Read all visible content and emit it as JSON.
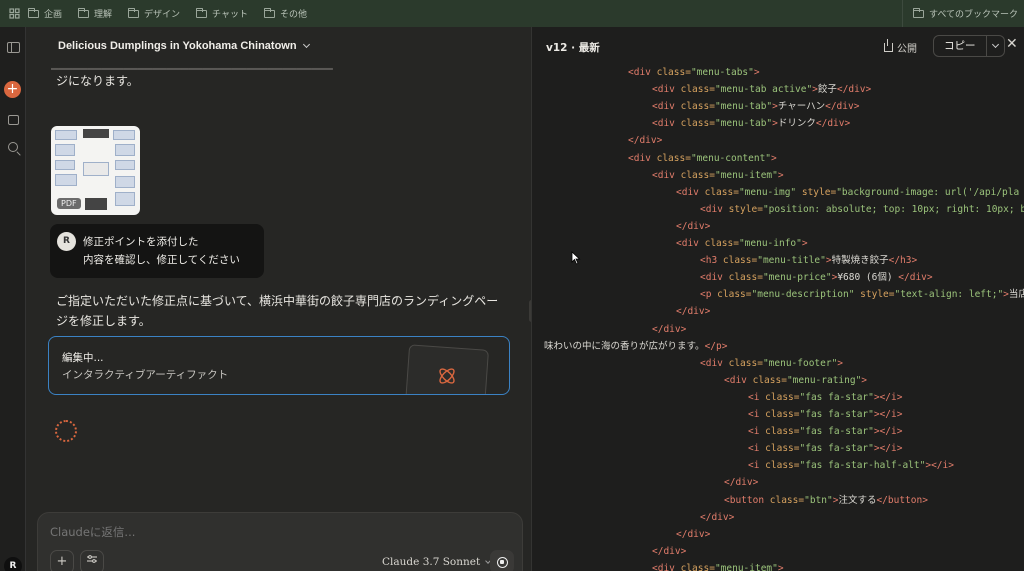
{
  "bookmarks_bar": {
    "items": [
      "企画",
      "理解",
      "デザイン",
      "チャット",
      "その他"
    ],
    "all_bookmarks": "すべてのブックマーク"
  },
  "rail": {
    "avatar": "R"
  },
  "chat": {
    "title": "Delicious Dumplings in Yokohama Chinatown",
    "prev_text": "ジになります。",
    "attachment": {
      "badge": "PDF"
    },
    "user_message": {
      "avatar": "R",
      "line1": "修正ポイントを添付した",
      "line2": "内容を確認し、修正してください"
    },
    "assistant_line1": "ご指定いただいた修正点に基づいて、横浜中華街の餃子専門店のランディングペー",
    "assistant_line2": "ジを修正します。",
    "artifact": {
      "title": "編集中...",
      "subtitle": "インタラクティブアーティファクト"
    },
    "composer": {
      "placeholder": "Claudeに返信...",
      "model": "Claude 3.7 Sonnet"
    }
  },
  "artifact_pane": {
    "version": "v12 · 最新",
    "publish": "公開",
    "copy": "コピー",
    "code_lines": [
      {
        "indent": 3,
        "parts": [
          [
            "tg",
            "<div "
          ],
          [
            "at",
            "class="
          ],
          [
            "st",
            "\"menu-tabs\""
          ],
          [
            "tg",
            ">"
          ]
        ]
      },
      {
        "indent": 4,
        "parts": [
          [
            "tg",
            "<div "
          ],
          [
            "at",
            "class="
          ],
          [
            "st",
            "\"menu-tab active\""
          ],
          [
            "tg",
            ">"
          ],
          [
            "tx",
            "餃子"
          ],
          [
            "tg",
            "</div>"
          ]
        ]
      },
      {
        "indent": 4,
        "parts": [
          [
            "tg",
            "<div "
          ],
          [
            "at",
            "class="
          ],
          [
            "st",
            "\"menu-tab\""
          ],
          [
            "tg",
            ">"
          ],
          [
            "tx",
            "チャーハン"
          ],
          [
            "tg",
            "</div>"
          ]
        ]
      },
      {
        "indent": 4,
        "parts": [
          [
            "tg",
            "<div "
          ],
          [
            "at",
            "class="
          ],
          [
            "st",
            "\"menu-tab\""
          ],
          [
            "tg",
            ">"
          ],
          [
            "tx",
            "ドリンク"
          ],
          [
            "tg",
            "</div>"
          ]
        ]
      },
      {
        "indent": 3,
        "parts": [
          [
            "tg",
            "</div>"
          ]
        ]
      },
      {
        "indent": 3,
        "parts": [
          [
            "tg",
            "<div "
          ],
          [
            "at",
            "class="
          ],
          [
            "st",
            "\"menu-content\""
          ],
          [
            "tg",
            ">"
          ]
        ]
      },
      {
        "indent": 4,
        "parts": [
          [
            "tg",
            "<div "
          ],
          [
            "at",
            "class="
          ],
          [
            "st",
            "\"menu-item\""
          ],
          [
            "tg",
            ">"
          ]
        ]
      },
      {
        "indent": 5,
        "parts": [
          [
            "tg",
            "<div "
          ],
          [
            "at",
            "class="
          ],
          [
            "st",
            "\"menu-img\" "
          ],
          [
            "at",
            "style="
          ],
          [
            "st",
            "\"background-image: url('/api/pla"
          ]
        ]
      },
      {
        "indent": 6,
        "parts": [
          [
            "tg",
            "<div "
          ],
          [
            "at",
            "style="
          ],
          [
            "st",
            "\"position: absolute; top: 10px; right: 10px; b"
          ]
        ]
      },
      {
        "indent": 5,
        "parts": [
          [
            "tg",
            "</div>"
          ]
        ]
      },
      {
        "indent": 5,
        "parts": [
          [
            "tg",
            "<div "
          ],
          [
            "at",
            "class="
          ],
          [
            "st",
            "\"menu-info\""
          ],
          [
            "tg",
            ">"
          ]
        ]
      },
      {
        "indent": 6,
        "parts": [
          [
            "tg",
            "<h3 "
          ],
          [
            "at",
            "class="
          ],
          [
            "st",
            "\"menu-title\""
          ],
          [
            "tg",
            ">"
          ],
          [
            "tx",
            "特製焼き餃子"
          ],
          [
            "tg",
            "</h3>"
          ]
        ]
      },
      {
        "indent": 6,
        "parts": [
          [
            "tg",
            "<div "
          ],
          [
            "at",
            "class="
          ],
          [
            "st",
            "\"menu-price\""
          ],
          [
            "tg",
            ">"
          ],
          [
            "tx",
            "¥680 (6個) "
          ],
          [
            "tg",
            "</div>"
          ]
        ]
      },
      {
        "indent": 6,
        "parts": [
          [
            "tg",
            "<p "
          ],
          [
            "at",
            "class="
          ],
          [
            "st",
            "\"menu-description\" "
          ],
          [
            "at",
            "style="
          ],
          [
            "st",
            "\"text-align: left;\""
          ],
          [
            "tg",
            ">"
          ],
          [
            "tx",
            "当店"
          ]
        ]
      },
      {
        "indent": 5,
        "parts": [
          [
            "tg",
            "</div>"
          ]
        ]
      },
      {
        "indent": 4,
        "parts": [
          [
            "tg",
            "</div>"
          ]
        ]
      },
      {
        "indent": 0,
        "parts": [
          [
            "tx",
            "味わいの中に海の香りが広がります。"
          ],
          [
            "tg",
            "</p>"
          ]
        ]
      },
      {
        "indent": 6,
        "parts": [
          [
            "tg",
            "<div "
          ],
          [
            "at",
            "class="
          ],
          [
            "st",
            "\"menu-footer\""
          ],
          [
            "tg",
            ">"
          ]
        ]
      },
      {
        "indent": 7,
        "parts": [
          [
            "tg",
            "<div "
          ],
          [
            "at",
            "class="
          ],
          [
            "st",
            "\"menu-rating\""
          ],
          [
            "tg",
            ">"
          ]
        ]
      },
      {
        "indent": 8,
        "parts": [
          [
            "tg",
            "<i "
          ],
          [
            "at",
            "class="
          ],
          [
            "st",
            "\"fas fa-star\""
          ],
          [
            "tg",
            "></i>"
          ]
        ]
      },
      {
        "indent": 8,
        "parts": [
          [
            "tg",
            "<i "
          ],
          [
            "at",
            "class="
          ],
          [
            "st",
            "\"fas fa-star\""
          ],
          [
            "tg",
            "></i>"
          ]
        ]
      },
      {
        "indent": 8,
        "parts": [
          [
            "tg",
            "<i "
          ],
          [
            "at",
            "class="
          ],
          [
            "st",
            "\"fas fa-star\""
          ],
          [
            "tg",
            "></i>"
          ]
        ]
      },
      {
        "indent": 8,
        "parts": [
          [
            "tg",
            "<i "
          ],
          [
            "at",
            "class="
          ],
          [
            "st",
            "\"fas fa-star\""
          ],
          [
            "tg",
            "></i>"
          ]
        ]
      },
      {
        "indent": 8,
        "parts": [
          [
            "tg",
            "<i "
          ],
          [
            "at",
            "class="
          ],
          [
            "st",
            "\"fas fa-star-half-alt\""
          ],
          [
            "tg",
            "></i>"
          ]
        ]
      },
      {
        "indent": 7,
        "parts": [
          [
            "tg",
            "</div>"
          ]
        ]
      },
      {
        "indent": 7,
        "parts": [
          [
            "tg",
            "<button "
          ],
          [
            "at",
            "class="
          ],
          [
            "st",
            "\"btn\""
          ],
          [
            "tg",
            ">"
          ],
          [
            "tx",
            "注文する"
          ],
          [
            "tg",
            "</button>"
          ]
        ]
      },
      {
        "indent": 6,
        "parts": [
          [
            "tg",
            "</div>"
          ]
        ]
      },
      {
        "indent": 5,
        "parts": [
          [
            "tg",
            "</div>"
          ]
        ]
      },
      {
        "indent": 4,
        "parts": [
          [
            "tg",
            "</div>"
          ]
        ]
      },
      {
        "indent": 4,
        "parts": [
          [
            "tg",
            "<div "
          ],
          [
            "at",
            "class="
          ],
          [
            "st",
            "\"menu-item\""
          ],
          [
            "tg",
            ">"
          ]
        ]
      }
    ]
  }
}
